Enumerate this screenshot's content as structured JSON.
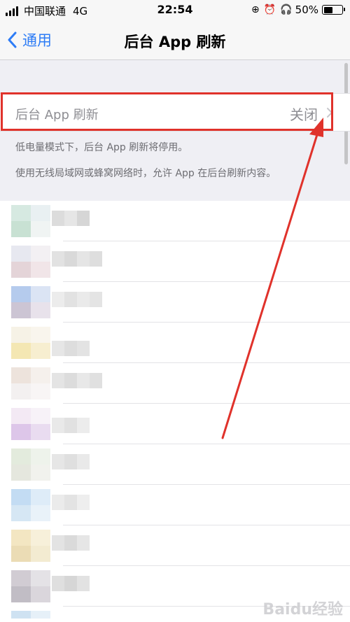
{
  "status_bar": {
    "carrier": "中国联通",
    "network": "4G",
    "time": "22:54",
    "battery": "50%",
    "battery_level": 0.5
  },
  "nav": {
    "back_label": "通用",
    "title": "后台 App 刷新"
  },
  "setting": {
    "label": "后台 App 刷新",
    "value": "关闭"
  },
  "footer": {
    "line1": "低电量模式下，后台 App 刷新将停用。",
    "line2": "使用无线局域网或蜂窝网络时，允许 App 在后台刷新内容。"
  },
  "colors": {
    "accent": "#2d7cf6",
    "annotation": "#e0322b"
  },
  "watermark": "Baidu经验"
}
